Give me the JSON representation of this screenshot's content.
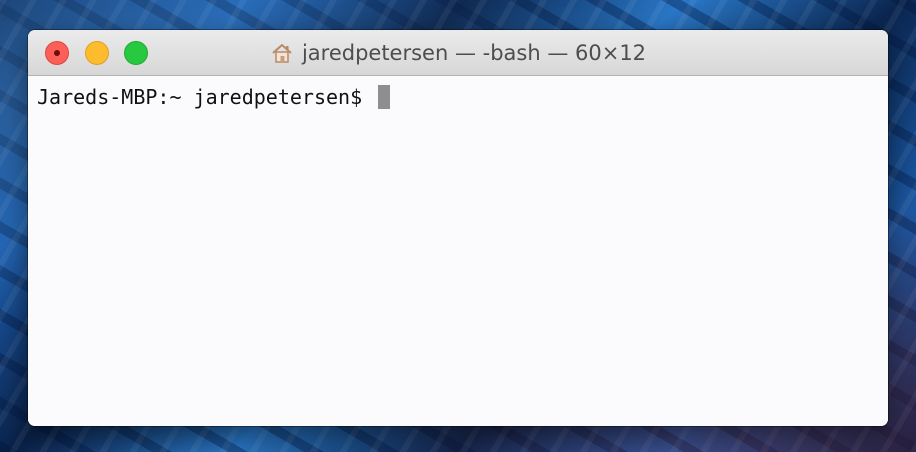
{
  "window": {
    "title": "jaredpetersen — -bash — 60×12",
    "title_icon": "home-icon",
    "buttons": {
      "close": "close-button",
      "minimize": "minimize-button",
      "zoom": "zoom-button"
    }
  },
  "terminal": {
    "prompt": "Jareds-MBP:~ jaredpetersen$ ",
    "cursor_color": "#8e8e8e"
  },
  "colors": {
    "close": "#fc5f57",
    "minimize": "#fdbc2e",
    "zoom": "#28c840",
    "terminal_background": "#fbfbfd"
  }
}
